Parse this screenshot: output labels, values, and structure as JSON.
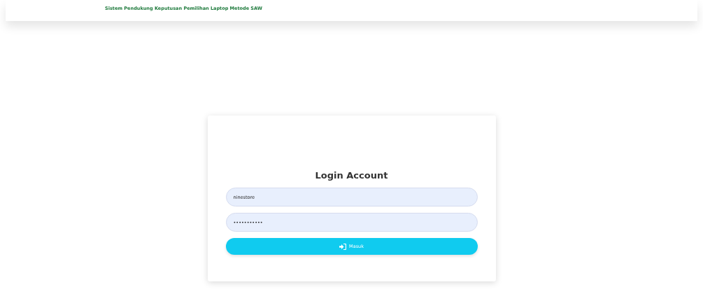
{
  "header": {
    "title": "Sistem Pendukung Keputusan Pemilihan Laptop Metode SAW"
  },
  "login": {
    "title": "Login Account",
    "username": {
      "value": "ninestore"
    },
    "password": {
      "value": "•••••••••••"
    },
    "submit": {
      "label": "Masuk"
    }
  }
}
